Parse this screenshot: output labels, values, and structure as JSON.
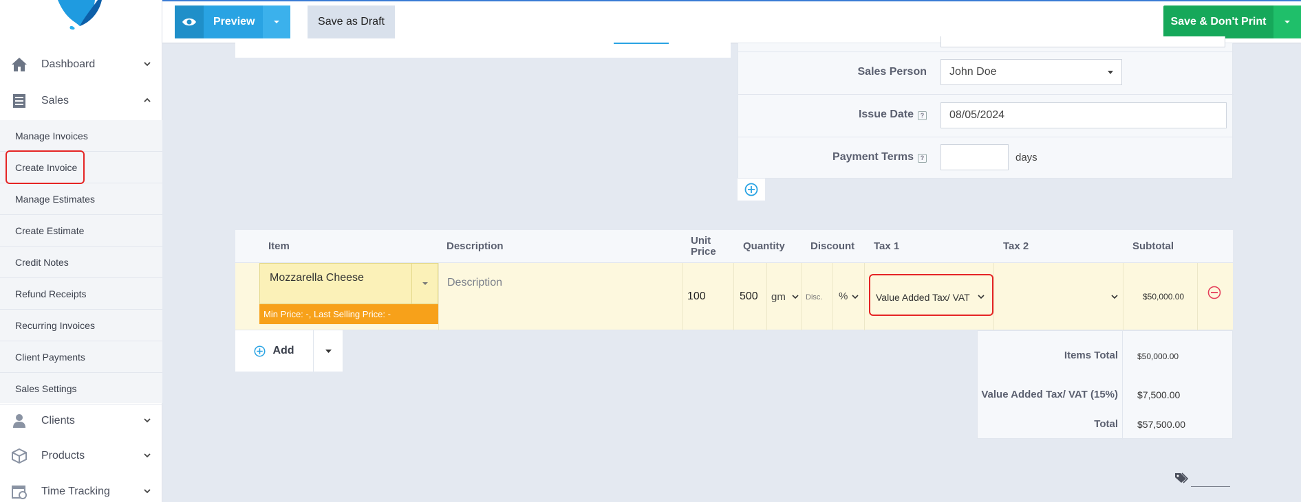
{
  "sidebar": {
    "items": [
      {
        "label": "Dashboard"
      },
      {
        "label": "Sales"
      },
      {
        "label": "Clients"
      },
      {
        "label": "Products"
      },
      {
        "label": "Time Tracking"
      }
    ],
    "sales_submenu": [
      {
        "label": "Manage Invoices"
      },
      {
        "label": "Create Invoice"
      },
      {
        "label": "Manage Estimates"
      },
      {
        "label": "Create Estimate"
      },
      {
        "label": "Credit Notes"
      },
      {
        "label": "Refund Receipts"
      },
      {
        "label": "Recurring Invoices"
      },
      {
        "label": "Client Payments"
      },
      {
        "label": "Sales Settings"
      }
    ]
  },
  "toolbar": {
    "preview_label": "Preview",
    "draft_label": "Save as Draft",
    "save_label": "Save & Don't Print"
  },
  "form": {
    "sales_person_label": "Sales Person",
    "sales_person_value": "John Doe",
    "issue_date_label": "Issue Date",
    "issue_date_value": "08/05/2024",
    "payment_terms_label": "Payment Terms",
    "payment_terms_value": "",
    "payment_terms_unit": "days",
    "help_glyph": "?"
  },
  "table": {
    "headers": {
      "item": "Item",
      "description": "Description",
      "unit_price_1": "Unit",
      "unit_price_2": "Price",
      "quantity": "Quantity",
      "discount": "Discount",
      "tax1": "Tax 1",
      "tax2": "Tax 2",
      "subtotal": "Subtotal"
    },
    "row": {
      "item": "Mozzarella Cheese",
      "min_price_note": "Min Price: -, Last Selling Price: -",
      "description_placeholder": "Description",
      "unit_price": "100",
      "quantity": "500",
      "unit": "gm",
      "discount_placeholder": "Disc.",
      "discount_type": "%",
      "tax1": "Value Added Tax/ VAT",
      "tax2": "",
      "subtotal": "$50,000.00"
    }
  },
  "add_label": "Add",
  "totals": {
    "items_total_label": "Items Total",
    "items_total_value": "$50,000.00",
    "vat_label": "Value Added Tax/ VAT (15%)",
    "vat_value": "$7,500.00",
    "total_label": "Total",
    "total_value": "$57,500.00"
  },
  "colors": {
    "primary": "#29a3e3",
    "success": "#16a85a",
    "highlight": "#e52424",
    "note": "#f7a11a"
  }
}
